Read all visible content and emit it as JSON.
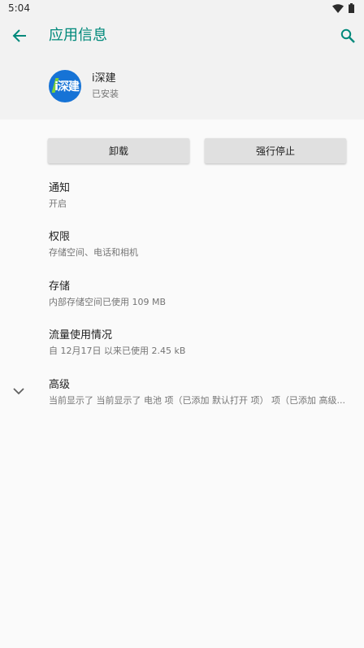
{
  "status_bar": {
    "time": "5:04"
  },
  "toolbar": {
    "title": "应用信息",
    "back_icon": "arrow-back-icon",
    "search_icon": "search-icon"
  },
  "app": {
    "name": "i深建",
    "status": "已安装",
    "logo_text": "i深建",
    "logo_color": "#1673d6"
  },
  "buttons": {
    "uninstall": "卸载",
    "force_stop": "强行停止"
  },
  "items": [
    {
      "title": "通知",
      "subtitle": "开启"
    },
    {
      "title": "权限",
      "subtitle": "存储空间、电话和相机"
    },
    {
      "title": "存储",
      "subtitle": "内部存储空间已使用 109 MB"
    },
    {
      "title": "流量使用情况",
      "subtitle": "自 12月17日 以来已使用 2.45 kB"
    },
    {
      "title": "高级",
      "subtitle": "当前显示了 当前显示了 电池 项（已添加 默认打开 项） 项（已添加 高级..."
    }
  ],
  "colors": {
    "accent": "#00897b",
    "header_bg": "#f2f2f2",
    "page_bg": "#fafafa"
  }
}
